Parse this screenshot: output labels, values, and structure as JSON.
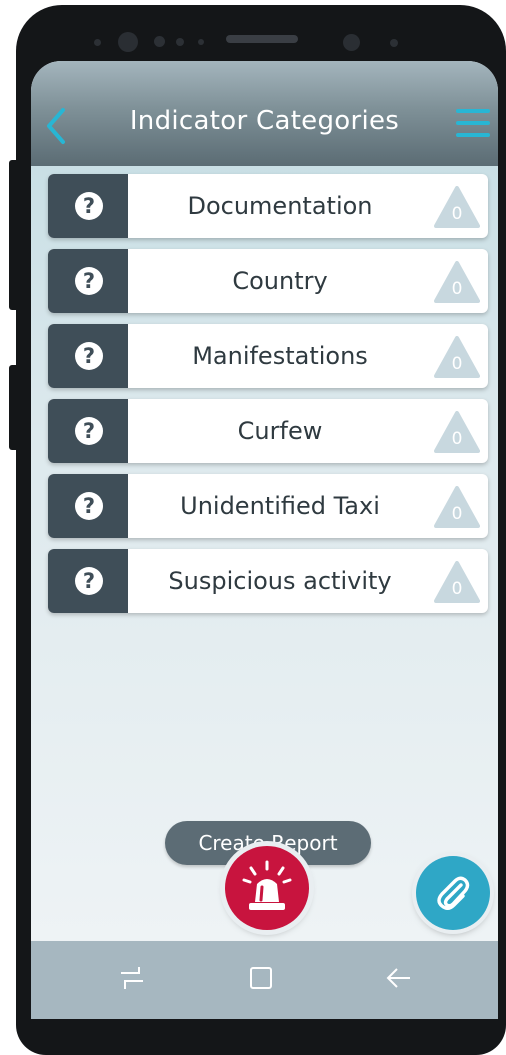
{
  "header": {
    "title": "Indicator Categories",
    "back_icon": "chevron-left-icon",
    "menu_icon": "hamburger-menu-icon",
    "accent": "#28b6d4"
  },
  "categories": [
    {
      "label": "Documentation",
      "count": "0",
      "icon": "question-circle-icon"
    },
    {
      "label": "Country",
      "count": "0",
      "icon": "question-circle-icon"
    },
    {
      "label": "Manifestations",
      "count": "0",
      "icon": "question-circle-icon"
    },
    {
      "label": "Curfew",
      "count": "0",
      "icon": "question-circle-icon"
    },
    {
      "label": "Unidentified Taxi",
      "count": "0",
      "icon": "question-circle-icon"
    },
    {
      "label": "Suspicious activity",
      "count": "0",
      "icon": "question-circle-icon"
    }
  ],
  "actions": {
    "create_report": "Create Report",
    "alarm_icon": "siren-icon",
    "attach_icon": "paperclip-icon",
    "alarm_color": "#c8143e",
    "attach_color": "#2fa7c6"
  },
  "system_nav": {
    "recent_icon": "recent-apps-icon",
    "home_icon": "home-square-icon",
    "back_icon": "back-arrow-icon"
  },
  "colors": {
    "row_dark": "#3f4e58",
    "badge": "#c8d8df"
  }
}
